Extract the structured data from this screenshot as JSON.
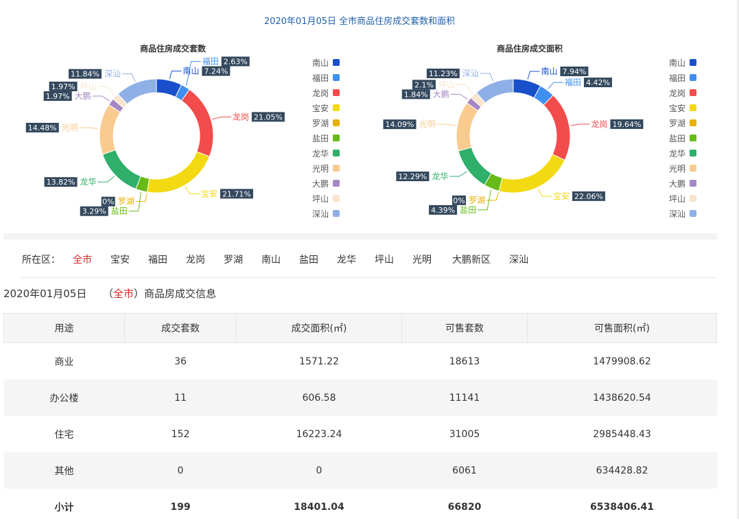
{
  "page_title": "2020年01月05日 全市商品住房成交套数和面积",
  "legend_colors": [
    "#1a4fcc",
    "#3f8ff0",
    "#f24c4c",
    "#f2d911",
    "#e8b000",
    "#66bb16",
    "#2eaf6a",
    "#f9cb8e",
    "#a587c4",
    "#f9e4cc",
    "#8fb0e6"
  ],
  "chart_data": [
    {
      "type": "pie",
      "title": "商品住房成交套数",
      "categories": [
        "南山",
        "福田",
        "龙岗",
        "宝安",
        "罗湖",
        "盐田",
        "龙华",
        "光明",
        "大鹏",
        "坪山",
        "深汕"
      ],
      "values": [
        7.24,
        2.63,
        21.05,
        21.71,
        0,
        3.29,
        13.82,
        14.48,
        1.97,
        1.97,
        11.84
      ],
      "value_labels": [
        "7.24%",
        "2.63%",
        "21.05%",
        "21.71%",
        "0%",
        "3.29%",
        "13.82%",
        "14.48%",
        "1.97%",
        "1.97%",
        "11.84%"
      ],
      "legend": "right"
    },
    {
      "type": "pie",
      "title": "商品住房成交面积",
      "categories": [
        "南山",
        "福田",
        "龙岗",
        "宝安",
        "罗湖",
        "盐田",
        "龙华",
        "光明",
        "大鹏",
        "坪山",
        "深汕"
      ],
      "values": [
        7.94,
        4.42,
        19.64,
        22.06,
        0,
        4.39,
        12.29,
        14.09,
        1.84,
        2.1,
        11.23
      ],
      "value_labels": [
        "7.94%",
        "4.42%",
        "19.64%",
        "22.06%",
        "0%",
        "4.39%",
        "12.29%",
        "14.09%",
        "1.84%",
        "2.1%",
        "11.23%"
      ],
      "legend": "right"
    }
  ],
  "district_filter": {
    "label": "所在区：",
    "selected": "全市",
    "items": [
      "全市",
      "宝安",
      "福田",
      "龙岗",
      "罗湖",
      "南山",
      "盐田",
      "龙华",
      "坪山",
      "光明",
      "大鹏新区",
      "深汕"
    ]
  },
  "info": {
    "date": "2020年01月05日",
    "open": "（",
    "district": "全市",
    "suffix": "）商品房成交信息"
  },
  "table": {
    "headers": [
      "用途",
      "成交套数",
      "成交面积(㎡)",
      "可售套数",
      "可售面积(㎡)"
    ],
    "rows": [
      [
        "商业",
        "36",
        "1571.22",
        "18613",
        "1479908.62"
      ],
      [
        "办公楼",
        "11",
        "606.58",
        "11141",
        "1438620.54"
      ],
      [
        "住宅",
        "152",
        "16223.24",
        "31005",
        "2985448.43"
      ],
      [
        "其他",
        "0",
        "0",
        "6061",
        "634428.82"
      ]
    ],
    "total": [
      "小计",
      "199",
      "18401.04",
      "66820",
      "6538406.41"
    ]
  }
}
